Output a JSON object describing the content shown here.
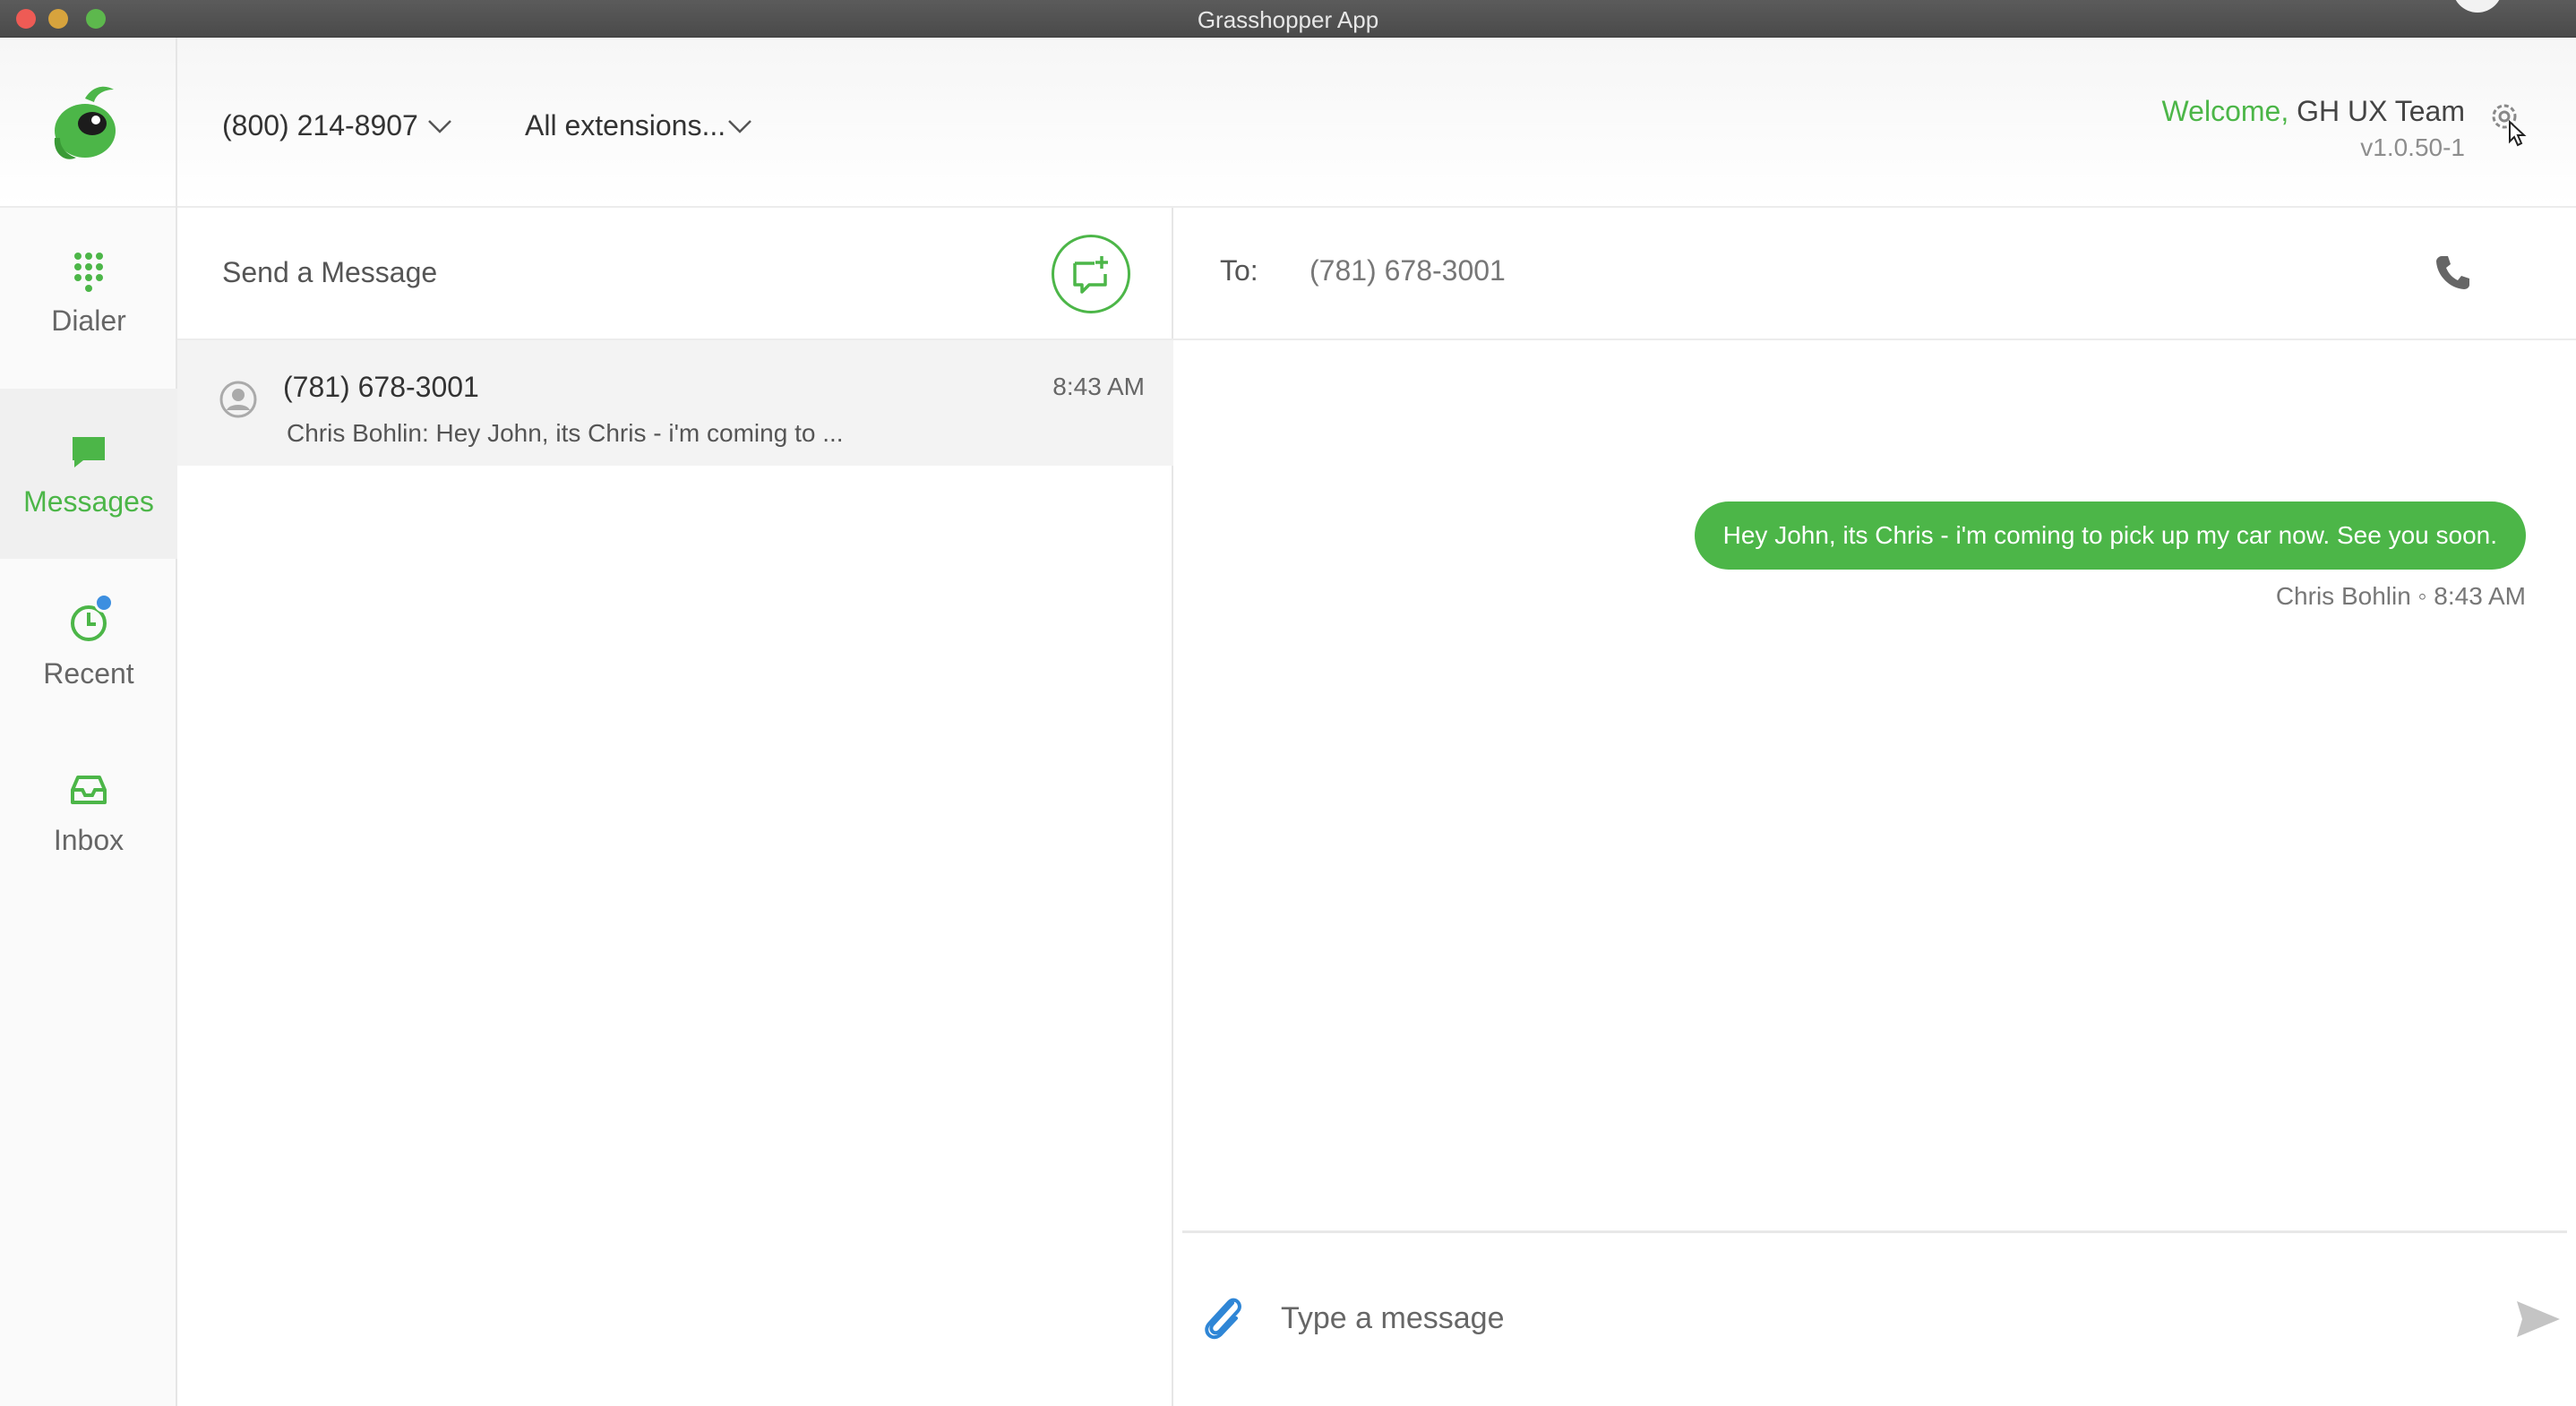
{
  "window": {
    "title": "Grasshopper App"
  },
  "header": {
    "phone_number": "(800) 214-8907",
    "extensions": "All extensions...",
    "welcome_word": "Welcome,",
    "user_name": "GH UX Team",
    "version": "v1.0.50-1"
  },
  "nav": {
    "items": [
      {
        "label": "Dialer",
        "icon": "dialpad-icon"
      },
      {
        "label": "Messages",
        "icon": "message-icon"
      },
      {
        "label": "Recent",
        "icon": "clock-icon"
      },
      {
        "label": "Inbox",
        "icon": "inbox-icon"
      }
    ],
    "active": "Messages"
  },
  "conversations": {
    "header_title": "Send a Message",
    "items": [
      {
        "name": "(781) 678-3001",
        "time": "8:43 AM",
        "preview": "Chris Bohlin: Hey John, its Chris - i'm coming to ..."
      }
    ]
  },
  "chat": {
    "to_label": "To:",
    "to_number": "(781) 678-3001",
    "messages": [
      {
        "text": "Hey John, its Chris - i'm coming to pick up my car now. See you soon.",
        "meta": "Chris Bohlin ◦ 8:43 AM"
      }
    ],
    "input_placeholder": "Type a message"
  },
  "colors": {
    "accent": "#4cb648",
    "badge": "#3d8fe0"
  }
}
